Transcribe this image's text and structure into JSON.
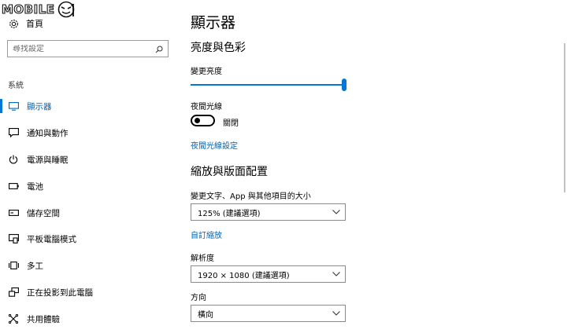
{
  "watermark": {
    "text": "MOBILE"
  },
  "nav": {
    "home_label": "首頁",
    "search_placeholder": "尋找設定",
    "section_label": "系統",
    "items": [
      {
        "label": "顯示器",
        "icon": "monitor-icon",
        "active": true
      },
      {
        "label": "通知與動作",
        "icon": "notification-icon"
      },
      {
        "label": "電源與睡眠",
        "icon": "power-icon"
      },
      {
        "label": "電池",
        "icon": "battery-icon"
      },
      {
        "label": "儲存空間",
        "icon": "storage-icon"
      },
      {
        "label": "平板電腦模式",
        "icon": "tablet-mode-icon"
      },
      {
        "label": "多工",
        "icon": "multitasking-icon"
      },
      {
        "label": "正在投影到此電腦",
        "icon": "projecting-icon"
      },
      {
        "label": "共用體驗",
        "icon": "shared-experiences-icon"
      }
    ]
  },
  "main": {
    "title": "顯示器",
    "brightness_section": "亮度與色彩",
    "brightness_label": "變更亮度",
    "brightness_value": 1.0,
    "night_light_label": "夜間光線",
    "night_light_state": "關閉",
    "night_light_settings_link": "夜間光線設定",
    "scale_section": "縮放與版面配置",
    "scale_label": "變更文字、App 與其他項目的大小",
    "scale_value": "125% (建議選項)",
    "custom_scaling_link": "自訂縮放",
    "resolution_label": "解析度",
    "resolution_value": "1920 × 1080 (建議選項)",
    "orientation_label": "方向",
    "orientation_value": "橫向"
  },
  "colors": {
    "accent": "#0078d7",
    "link": "#0063b1"
  }
}
